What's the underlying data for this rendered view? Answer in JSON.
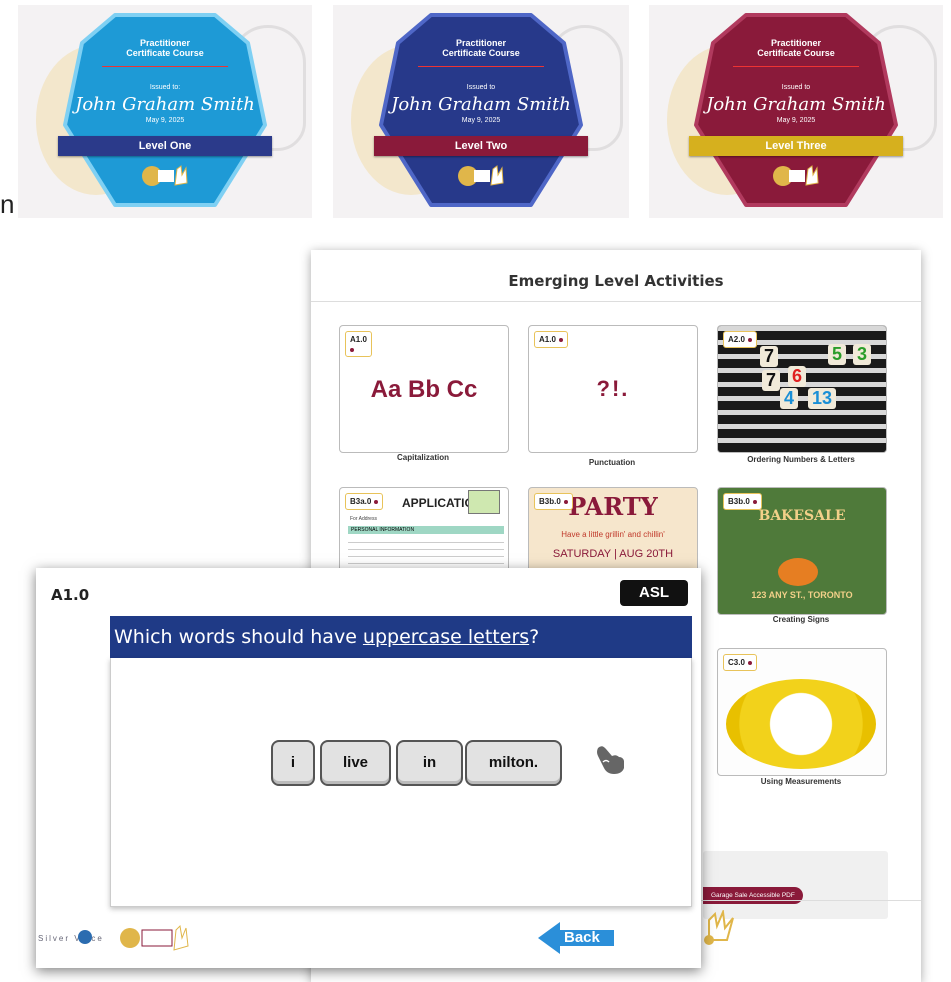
{
  "certificates": [
    {
      "title_line1": "Practitioner",
      "title_line2": "Certificate Course",
      "issued_label": "Issued to:",
      "name": "John Graham Smith",
      "date": "May 9, 2025",
      "level": "Level One",
      "hex_color": "#1e9ad6",
      "hex_border": "#7fd0f3",
      "ribbon_color": "#2b3a8a"
    },
    {
      "title_line1": "Practitioner",
      "title_line2": "Certificate Course",
      "issued_label": "Issued to",
      "name": "John Graham Smith",
      "date": "May 9, 2025",
      "level": "Level Two",
      "hex_color": "#27398a",
      "hex_border": "#4f67c7",
      "ribbon_color": "#8a1a3a"
    },
    {
      "title_line1": "Practitioner",
      "title_line2": "Certificate Course",
      "issued_label": "Issued to",
      "name": "John Graham Smith",
      "date": "May 9, 2025",
      "level": "Level Three",
      "hex_color": "#8a1a3a",
      "hex_border": "#b13a5e",
      "ribbon_color": "#d6b01e"
    }
  ],
  "edge_letter": "n",
  "activities_panel": {
    "title": "Emerging Level Activities",
    "cards": [
      {
        "badge": "A1.0",
        "preview_text": "Aa Bb Cc",
        "caption": "Capitalization"
      },
      {
        "badge": "A1.0",
        "preview_text": "?!.",
        "caption": "Punctuation"
      },
      {
        "badge": "A2.0",
        "caption": "Ordering Numbers & Letters",
        "tiles": [
          "7",
          "7",
          "6",
          "5",
          "3",
          "4",
          "13"
        ]
      },
      {
        "badge": "B3a.0",
        "preview_text": "APPLICATION",
        "sub_a": "For Address",
        "sub_b": "PERSONAL INFORMATION"
      },
      {
        "badge": "B3b.0",
        "preview_text": "PARTY",
        "sub_a": "Have a little grillin' and chillin'",
        "sub_b": "SATURDAY | AUG 20TH"
      },
      {
        "badge": "B3b.0",
        "preview_text": "BAKESALE",
        "sub_a": "123 ANY ST., TORONTO",
        "caption": "Creating Signs"
      },
      {
        "badge": "C3.0",
        "caption": "Using Measurements"
      }
    ],
    "pdf_button": "Garage Sale Accessible PDF"
  },
  "quiz": {
    "code": "A1.0",
    "asl_label": "ASL",
    "question_prefix": "Which words should have ",
    "question_link": "uppercase letters",
    "question_suffix": "?",
    "words": [
      "i",
      "live",
      "in",
      "milton."
    ],
    "back_label": "Back",
    "footer_brand": "Silver Voice"
  },
  "colors": {
    "maroon": "#8a1a3a",
    "navy": "#1f3a86",
    "back_arrow": "#2b8fd9"
  }
}
